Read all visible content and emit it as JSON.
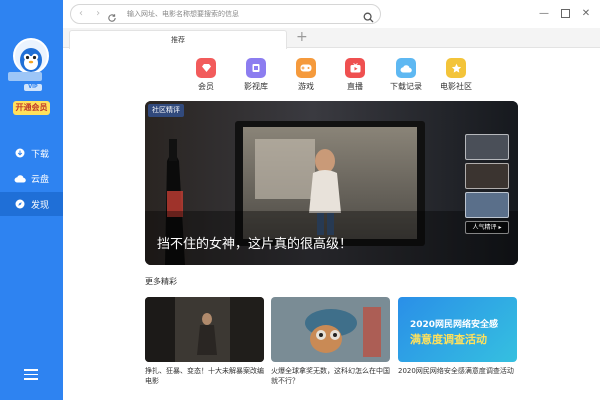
{
  "search": {
    "placeholder": "输入网址、电影名称想要搜索的信息"
  },
  "tabs": [
    {
      "label": "推荐"
    }
  ],
  "sidebar": {
    "open_vip": "开通会员",
    "vip_badge": "VIP",
    "items": [
      {
        "label": "下载",
        "icon": "download-icon"
      },
      {
        "label": "云盘",
        "icon": "cloud-icon"
      },
      {
        "label": "发现",
        "icon": "compass-icon",
        "active": true
      }
    ]
  },
  "quick_links": [
    {
      "label": "会员",
      "color": "#f25b5b",
      "icon": "diamond-icon"
    },
    {
      "label": "影视库",
      "color": "#8c7df0",
      "icon": "film-icon"
    },
    {
      "label": "游戏",
      "color": "#f59a3c",
      "icon": "gamepad-icon"
    },
    {
      "label": "直播",
      "color": "#ef5050",
      "icon": "tv-icon"
    },
    {
      "label": "下载记录",
      "color": "#5eb8f2",
      "icon": "cloud-download-icon"
    },
    {
      "label": "电影社区",
      "color": "#f3c43a",
      "icon": "star-icon"
    }
  ],
  "hero": {
    "tag": "社区精评",
    "title": "挡不住的女神，这片真的很高级！",
    "popular_label": "人气精评 ▸"
  },
  "more": {
    "title": "更多精彩",
    "cards": [
      {
        "caption": "挣扎、狂暴、变态！十大未解暴案改编电影"
      },
      {
        "caption": "火爆全球拿奖无数，这科幻怎么在中国就不行？"
      },
      {
        "caption": "2020网民网络安全感满意度调查活动",
        "banner_line1": "2020网民网络安全感",
        "banner_line2": "满意度调查活动"
      }
    ]
  },
  "colors": {
    "sidebar": "#2e83f1",
    "accent_yellow": "#ffe15c"
  }
}
